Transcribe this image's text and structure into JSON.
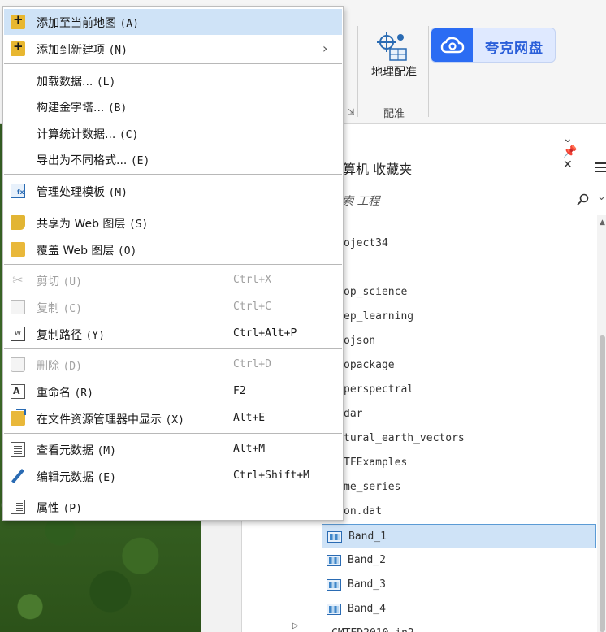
{
  "ribbon": {
    "georeference_label": "地理配准",
    "group_label": "配准",
    "cloud_button_label": "夸克网盘",
    "dialog_launcher": "⇲"
  },
  "catalog": {
    "pane_controls": "⌄ 📌 ✕",
    "tabs_text": "算机  收藏夹",
    "search_placeholder": "索 工程",
    "search_chevron": "⌄",
    "items": [
      {
        "label": "oject34"
      },
      {
        "label": "op_science"
      },
      {
        "label": "ep_learning"
      },
      {
        "label": "ojson"
      },
      {
        "label": "opackage"
      },
      {
        "label": "perspectral"
      },
      {
        "label": "dar"
      },
      {
        "label": "tural_earth_vectors"
      },
      {
        "label": "TFExamples"
      },
      {
        "label": "me_series"
      },
      {
        "label": "on.dat"
      }
    ],
    "rasters": [
      {
        "label": "Band_1",
        "selected": true
      },
      {
        "label": "Band_2",
        "selected": false
      },
      {
        "label": "Band_3",
        "selected": false
      },
      {
        "label": "Band_4",
        "selected": false
      }
    ],
    "last_item_label": "CMTED2010_in2"
  },
  "context_menu": {
    "items": [
      {
        "label": "添加至当前地图",
        "key": "(A)",
        "shortcut": "",
        "icon": "folder-plus-icon",
        "highlight": true,
        "disabled": false
      },
      {
        "label": "添加到新建项",
        "key": "(N)",
        "shortcut": "",
        "icon": "folder-plus-icon",
        "submenu": true,
        "disabled": false
      },
      {
        "label": "加载数据...",
        "key": "(L)",
        "shortcut": "",
        "icon": "",
        "disabled": false
      },
      {
        "label": "构建金字塔...",
        "key": "(B)",
        "shortcut": "",
        "icon": "",
        "disabled": false
      },
      {
        "label": "计算统计数据...",
        "key": "(C)",
        "shortcut": "",
        "icon": "",
        "disabled": false
      },
      {
        "label": "导出为不同格式...",
        "key": "(E)",
        "shortcut": "",
        "icon": "",
        "disabled": false
      },
      {
        "label": "管理处理模板",
        "key": "(M)",
        "shortcut": "",
        "icon": "processing-template-icon",
        "disabled": false
      },
      {
        "label": "共享为 Web 图层",
        "key": "(S)",
        "shortcut": "",
        "icon": "share-web-layer-icon",
        "disabled": false
      },
      {
        "label": "覆盖 Web 图层",
        "key": "(O)",
        "shortcut": "",
        "icon": "overwrite-web-layer-icon",
        "disabled": false
      },
      {
        "label": "剪切",
        "key": "(U)",
        "shortcut": "Ctrl+X",
        "icon": "scissors-icon",
        "disabled": true
      },
      {
        "label": "复制",
        "key": "(C)",
        "shortcut": "Ctrl+C",
        "icon": "copy-icon",
        "disabled": true
      },
      {
        "label": "复制路径",
        "key": "(Y)",
        "shortcut": "Ctrl+Alt+P",
        "icon": "copy-path-icon",
        "disabled": false
      },
      {
        "label": "删除",
        "key": "(D)",
        "shortcut": "Ctrl+D",
        "icon": "trash-icon",
        "disabled": true
      },
      {
        "label": "重命名",
        "key": "(R)",
        "shortcut": "F2",
        "icon": "rename-icon",
        "disabled": false
      },
      {
        "label": "在文件资源管理器中显示",
        "key": "(X)",
        "shortcut": "Alt+E",
        "icon": "open-folder-icon",
        "disabled": false
      },
      {
        "label": "查看元数据",
        "key": "(M)",
        "shortcut": "Alt+M",
        "icon": "view-metadata-icon",
        "disabled": false
      },
      {
        "label": "编辑元数据",
        "key": "(E)",
        "shortcut": "Ctrl+Shift+M",
        "icon": "edit-metadata-icon",
        "disabled": false
      },
      {
        "label": "属性",
        "key": "(P)",
        "shortcut": "",
        "icon": "properties-icon",
        "disabled": false
      }
    ]
  }
}
